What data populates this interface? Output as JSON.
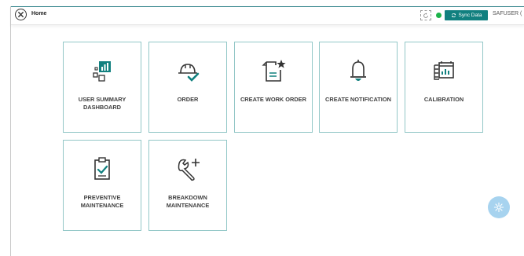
{
  "header": {
    "title": "Home",
    "sync_label": "Sync Data",
    "user": "SAFUSER (",
    "status_color": "#1db34a",
    "accent": "#11807f"
  },
  "tiles": [
    {
      "label": "USER SUMMARY DASHBOARD",
      "icon": "dashboard-icon"
    },
    {
      "label": "ORDER",
      "icon": "hardhat-check-icon"
    },
    {
      "label": "CREATE WORK ORDER",
      "icon": "document-star-icon"
    },
    {
      "label": "CREATE NOTIFICATION",
      "icon": "bell-icon"
    },
    {
      "label": "CALIBRATION",
      "icon": "calibration-icon"
    },
    {
      "label": "PREVENTIVE MAINTENANCE",
      "icon": "clipboard-check-icon"
    },
    {
      "label": "BREAKDOWN MAINTENANCE",
      "icon": "wrench-plus-icon"
    }
  ]
}
